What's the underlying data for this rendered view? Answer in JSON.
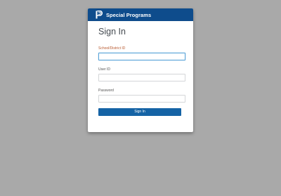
{
  "header": {
    "brand": "Special Programs",
    "logo_icon": "p-logo-icon"
  },
  "form": {
    "title": "Sign In",
    "fields": [
      {
        "label": "School/District ID",
        "value": "",
        "focused": true
      },
      {
        "label": "User ID",
        "value": ""
      },
      {
        "label": "Password",
        "value": ""
      }
    ],
    "submit_label": "Sign In"
  },
  "colors": {
    "background": "#a9a9a9",
    "header": "#0e4c8c",
    "button": "#1563a5",
    "focus_border": "#5aa4d8"
  }
}
